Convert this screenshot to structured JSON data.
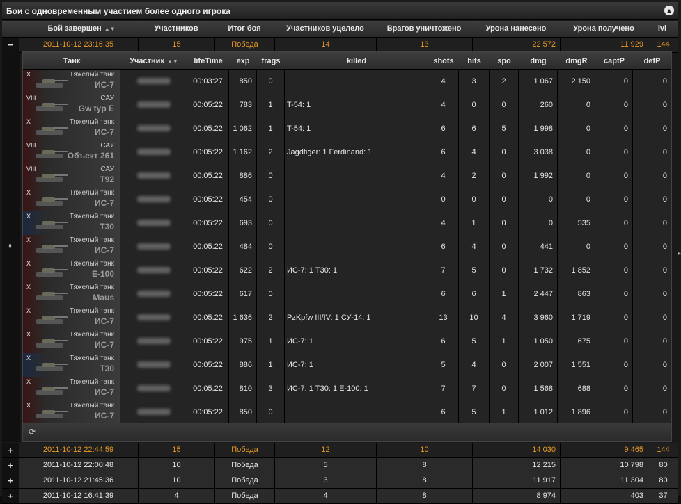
{
  "title": "Бои с одновременным участием более одного игрока",
  "outer_columns": [
    "Бой завершен",
    "Участников",
    "Итог боя",
    "Участников уцелело",
    "Врагов уничтожено",
    "Урона нанесено",
    "Урона получено",
    "lvl"
  ],
  "detail_columns": [
    "Танк",
    "Участник",
    "lifeTime",
    "exp",
    "frags",
    "killed",
    "shots",
    "hits",
    "spo",
    "dmg",
    "dmgR",
    "captP",
    "defP"
  ],
  "expanded_battle": {
    "expander": "−",
    "date": "2011-10-12 23:16:35",
    "participants": "15",
    "result": "Победа",
    "survived": "14",
    "enemies_destroyed": "13",
    "damage_dealt": "22 572",
    "damage_received": "11 929",
    "lvl": "144"
  },
  "details": [
    {
      "tier": "X",
      "type": "Тяжелый танк",
      "name": "ИС-7",
      "lifetime": "00:03:27",
      "exp": "850",
      "frags": "0",
      "killed": "",
      "shots": "4",
      "hits": "3",
      "spo": "2",
      "dmg": "1 067",
      "dmgR": "2 150",
      "captP": "0",
      "defP": "0"
    },
    {
      "tier": "VIII",
      "type": "САУ",
      "name": "Gw typ E",
      "lifetime": "00:05:22",
      "exp": "783",
      "frags": "1",
      "killed": "T-54: 1",
      "shots": "4",
      "hits": "0",
      "spo": "0",
      "dmg": "260",
      "dmgR": "0",
      "captP": "0",
      "defP": "0"
    },
    {
      "tier": "X",
      "type": "Тяжелый танк",
      "name": "ИС-7",
      "lifetime": "00:05:22",
      "exp": "1 062",
      "frags": "1",
      "killed": "T-54: 1",
      "shots": "6",
      "hits": "6",
      "spo": "5",
      "dmg": "1 998",
      "dmgR": "0",
      "captP": "0",
      "defP": "0"
    },
    {
      "tier": "VIII",
      "type": "САУ",
      "name": "Объект 261",
      "lifetime": "00:05:22",
      "exp": "1 162",
      "frags": "2",
      "killed": "Jagdtiger: 1  Ferdinand: 1",
      "shots": "6",
      "hits": "4",
      "spo": "0",
      "dmg": "3 038",
      "dmgR": "0",
      "captP": "0",
      "defP": "0"
    },
    {
      "tier": "VIII",
      "type": "САУ",
      "name": "T92",
      "lifetime": "00:05:22",
      "exp": "886",
      "frags": "0",
      "killed": "",
      "shots": "4",
      "hits": "2",
      "spo": "0",
      "dmg": "1 992",
      "dmgR": "0",
      "captP": "0",
      "defP": "0"
    },
    {
      "tier": "X",
      "type": "Тяжелый танк",
      "name": "ИС-7",
      "lifetime": "00:05:22",
      "exp": "454",
      "frags": "0",
      "killed": "",
      "shots": "0",
      "hits": "0",
      "spo": "0",
      "dmg": "0",
      "dmgR": "0",
      "captP": "0",
      "defP": "0"
    },
    {
      "tier": "X",
      "type": "Тяжелый танк",
      "name": "T30",
      "lifetime": "00:05:22",
      "exp": "693",
      "frags": "0",
      "killed": "",
      "shots": "4",
      "hits": "1",
      "spo": "0",
      "dmg": "0",
      "dmgR": "535",
      "captP": "0",
      "defP": "0",
      "blue": true
    },
    {
      "tier": "X",
      "type": "Тяжелый танк",
      "name": "ИС-7",
      "lifetime": "00:05:22",
      "exp": "484",
      "frags": "0",
      "killed": "",
      "shots": "6",
      "hits": "4",
      "spo": "0",
      "dmg": "441",
      "dmgR": "0",
      "captP": "0",
      "defP": "0"
    },
    {
      "tier": "X",
      "type": "Тяжелый танк",
      "name": "E-100",
      "lifetime": "00:05:22",
      "exp": "622",
      "frags": "2",
      "killed": "ИС-7: 1  T30: 1",
      "shots": "7",
      "hits": "5",
      "spo": "0",
      "dmg": "1 732",
      "dmgR": "1 852",
      "captP": "0",
      "defP": "0"
    },
    {
      "tier": "X",
      "type": "Тяжелый танк",
      "name": "Maus",
      "lifetime": "00:05:22",
      "exp": "617",
      "frags": "0",
      "killed": "",
      "shots": "6",
      "hits": "6",
      "spo": "1",
      "dmg": "2 447",
      "dmgR": "863",
      "captP": "0",
      "defP": "0"
    },
    {
      "tier": "X",
      "type": "Тяжелый танк",
      "name": "ИС-7",
      "lifetime": "00:05:22",
      "exp": "1 636",
      "frags": "2",
      "killed": "PzKpfw III/IV: 1  СУ-14: 1",
      "shots": "13",
      "hits": "10",
      "spo": "4",
      "dmg": "3 960",
      "dmgR": "1 719",
      "captP": "0",
      "defP": "0"
    },
    {
      "tier": "X",
      "type": "Тяжелый танк",
      "name": "ИС-7",
      "lifetime": "00:05:22",
      "exp": "975",
      "frags": "1",
      "killed": "ИС-7: 1",
      "shots": "6",
      "hits": "5",
      "spo": "1",
      "dmg": "1 050",
      "dmgR": "675",
      "captP": "0",
      "defP": "0"
    },
    {
      "tier": "X",
      "type": "Тяжелый танк",
      "name": "T30",
      "lifetime": "00:05:22",
      "exp": "886",
      "frags": "1",
      "killed": "ИС-7: 1",
      "shots": "5",
      "hits": "4",
      "spo": "0",
      "dmg": "2 007",
      "dmgR": "1 551",
      "captP": "0",
      "defP": "0",
      "blue": true
    },
    {
      "tier": "X",
      "type": "Тяжелый танк",
      "name": "ИС-7",
      "lifetime": "00:05:22",
      "exp": "810",
      "frags": "3",
      "killed": "ИС-7: 1  T30: 1  E-100: 1",
      "shots": "7",
      "hits": "7",
      "spo": "0",
      "dmg": "1 568",
      "dmgR": "688",
      "captP": "0",
      "defP": "0"
    },
    {
      "tier": "X",
      "type": "Тяжелый танк",
      "name": "ИС-7",
      "lifetime": "00:05:22",
      "exp": "850",
      "frags": "0",
      "killed": "",
      "shots": "6",
      "hits": "5",
      "spo": "1",
      "dmg": "1 012",
      "dmgR": "1 896",
      "captP": "0",
      "defP": "0"
    }
  ],
  "other_battles": [
    {
      "expander": "+",
      "date": "2011-10-12 22:44:59",
      "participants": "15",
      "result": "Победа",
      "survived": "12",
      "enemies_destroyed": "10",
      "damage_dealt": "14 030",
      "damage_received": "9 465",
      "lvl": "144",
      "highlight": true
    },
    {
      "expander": "+",
      "date": "2011-10-12 22:00:48",
      "participants": "10",
      "result": "Победа",
      "survived": "5",
      "enemies_destroyed": "8",
      "damage_dealt": "12 215",
      "damage_received": "10 798",
      "lvl": "80"
    },
    {
      "expander": "+",
      "date": "2011-10-12 21:45:36",
      "participants": "10",
      "result": "Победа",
      "survived": "3",
      "enemies_destroyed": "8",
      "damage_dealt": "11 917",
      "damage_received": "11 304",
      "lvl": "80"
    },
    {
      "expander": "+",
      "date": "2011-10-12 16:41:39",
      "participants": "4",
      "result": "Победа",
      "survived": "4",
      "enemies_destroyed": "8",
      "damage_dealt": "8 974",
      "damage_received": "403",
      "lvl": "37"
    }
  ],
  "icons": {
    "collapse": "collapse-up-icon",
    "sort": "sort-arrows-icon",
    "refresh": "refresh-icon"
  }
}
